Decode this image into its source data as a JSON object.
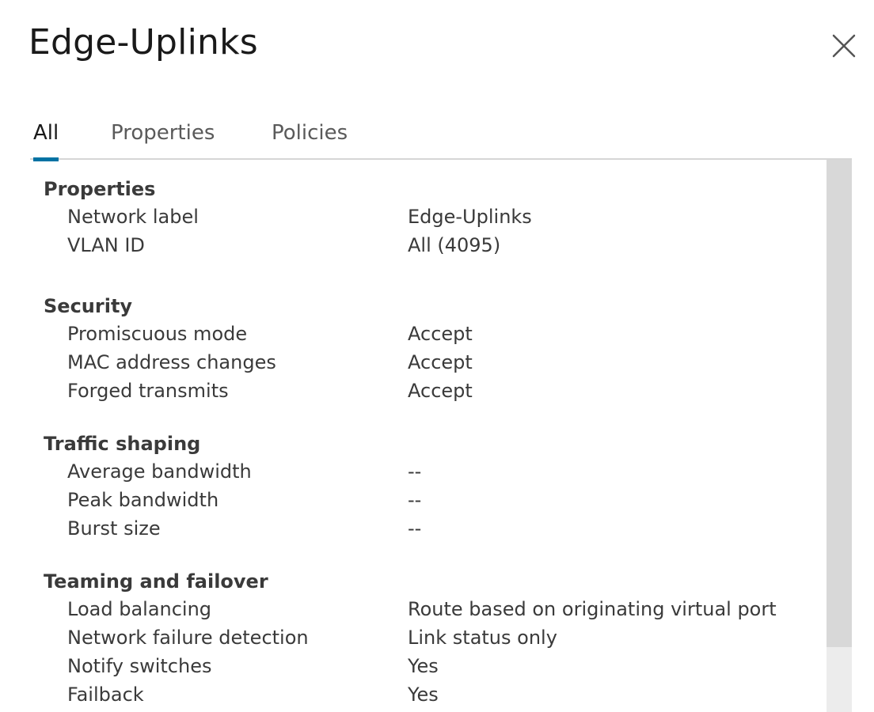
{
  "dialog": {
    "title": "Edge-Uplinks"
  },
  "tabs": [
    {
      "label": "All",
      "active": true
    },
    {
      "label": "Properties",
      "active": false
    },
    {
      "label": "Policies",
      "active": false
    }
  ],
  "colors": {
    "accent": "#0072a3",
    "tab_border": "#d6d6d6",
    "scrollbar_track": "#ececec",
    "scrollbar_thumb": "#d8d8d8"
  },
  "icons": {
    "close": "close-icon"
  },
  "sections": {
    "properties": {
      "title": "Properties",
      "rows": [
        {
          "label": "Network label",
          "value": "Edge-Uplinks"
        },
        {
          "label": "VLAN ID",
          "value": "All (4095)"
        }
      ]
    },
    "security": {
      "title": "Security",
      "rows": [
        {
          "label": "Promiscuous mode",
          "value": "Accept"
        },
        {
          "label": "MAC address changes",
          "value": "Accept"
        },
        {
          "label": "Forged transmits",
          "value": "Accept"
        }
      ]
    },
    "traffic_shaping": {
      "title": "Traffic shaping",
      "rows": [
        {
          "label": "Average bandwidth",
          "value": "--"
        },
        {
          "label": "Peak bandwidth",
          "value": "--"
        },
        {
          "label": "Burst size",
          "value": "--"
        }
      ]
    },
    "teaming": {
      "title": "Teaming and failover",
      "rows": [
        {
          "label": "Load balancing",
          "value": "Route based on originating virtual port"
        },
        {
          "label": "Network failure detection",
          "value": "Link status only"
        },
        {
          "label": "Notify switches",
          "value": "Yes"
        },
        {
          "label": "Failback",
          "value": "Yes"
        }
      ]
    }
  }
}
